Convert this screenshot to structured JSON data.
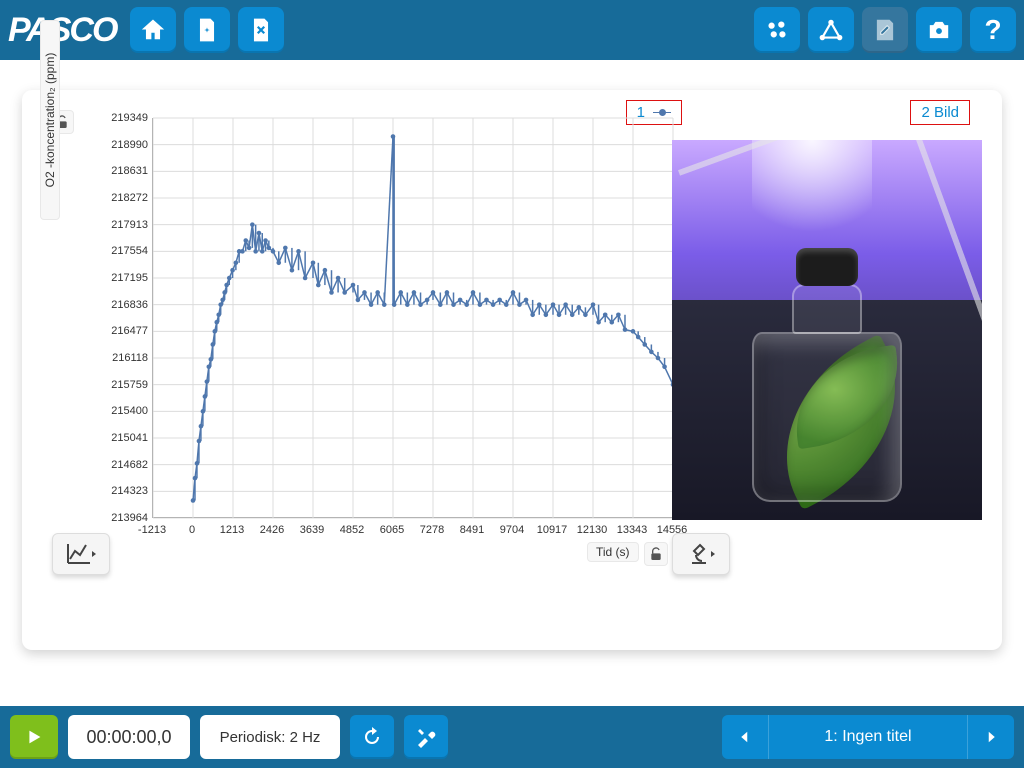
{
  "brand": "PASCO",
  "colors": {
    "topbar": "#176b99",
    "accent": "#0b8ad1",
    "play": "#7fbf1c",
    "series": "#4f77ad",
    "legend_border": "#d11"
  },
  "topbar": {
    "home_label": "Hem",
    "new_label": "Ny",
    "close_label": "Stäng",
    "sensors_label": "Sensorer",
    "geometry_label": "Verktyg",
    "edit_label": "Redigera",
    "camera_label": "Kamera",
    "help_label": "?"
  },
  "graph": {
    "legend_series": "1",
    "y_axis_label": "O2 -koncentration₂ (ppm)",
    "x_axis_label": "Tid (s)",
    "tools_label": "Grafverktyg"
  },
  "image_panel": {
    "legend": "2 Bild",
    "tools_label": "Bildverktyg",
    "description": "glass jar with green leaf and tube under purple light"
  },
  "bottombar": {
    "time": "00:00:00,0",
    "mode": "Periodisk: 2 Hz",
    "replay_label": "Repris",
    "settings_label": "Inställningar",
    "prev_label": "Föregående",
    "next_label": "Nästa",
    "page_title": "1: Ingen titel"
  },
  "chart_data": {
    "type": "scatter",
    "title": "",
    "xlabel": "Tid (s)",
    "ylabel": "O2 -koncentration₂ (ppm)",
    "xlim": [
      -1213,
      14556
    ],
    "ylim": [
      213964,
      219349
    ],
    "x_ticks": [
      -1213,
      0,
      1213,
      2426,
      3639,
      4852,
      6065,
      7278,
      8491,
      9704,
      10917,
      12130,
      13343,
      14556
    ],
    "y_ticks": [
      213964,
      214323,
      214682,
      215041,
      215400,
      215759,
      216118,
      216477,
      216836,
      217195,
      217554,
      217913,
      218272,
      218631,
      218990,
      219349
    ],
    "series": [
      {
        "name": "1",
        "x": [
          0,
          60,
          120,
          180,
          240,
          300,
          360,
          420,
          480,
          540,
          600,
          660,
          720,
          780,
          840,
          900,
          960,
          1020,
          1100,
          1200,
          1300,
          1400,
          1500,
          1600,
          1700,
          1800,
          1900,
          2000,
          2100,
          2200,
          2300,
          2426,
          2600,
          2800,
          3000,
          3200,
          3400,
          3639,
          3800,
          4000,
          4200,
          4400,
          4600,
          4852,
          5000,
          5200,
          5400,
          5600,
          5800,
          6065,
          6100,
          6300,
          6500,
          6700,
          6900,
          7100,
          7278,
          7500,
          7700,
          7900,
          8100,
          8300,
          8491,
          8700,
          8900,
          9100,
          9300,
          9500,
          9704,
          9900,
          10100,
          10300,
          10500,
          10700,
          10917,
          11100,
          11300,
          11500,
          11700,
          11900,
          12130,
          12300,
          12500,
          12700,
          12900,
          13100,
          13343,
          13500,
          13700,
          13900,
          14100,
          14300,
          14556
        ],
        "y": [
          214200,
          214500,
          214700,
          215000,
          215200,
          215400,
          215600,
          215800,
          216000,
          216100,
          216300,
          216477,
          216600,
          216700,
          216836,
          216900,
          217000,
          217100,
          217195,
          217300,
          217400,
          217554,
          217554,
          217700,
          217600,
          217913,
          217554,
          217800,
          217554,
          217700,
          217600,
          217554,
          217400,
          217600,
          217300,
          217554,
          217195,
          217400,
          217100,
          217300,
          217000,
          217195,
          217000,
          217100,
          216900,
          217000,
          216836,
          217000,
          216836,
          219100,
          216836,
          217000,
          216836,
          217000,
          216836,
          216900,
          217000,
          216836,
          217000,
          216836,
          216900,
          216836,
          217000,
          216836,
          216900,
          216836,
          216900,
          216836,
          217000,
          216836,
          216900,
          216700,
          216836,
          216700,
          216836,
          216700,
          216836,
          216700,
          216800,
          216700,
          216836,
          216600,
          216700,
          216600,
          216700,
          216500,
          216477,
          216400,
          216300,
          216200,
          216118,
          216000,
          215759
        ]
      }
    ]
  }
}
